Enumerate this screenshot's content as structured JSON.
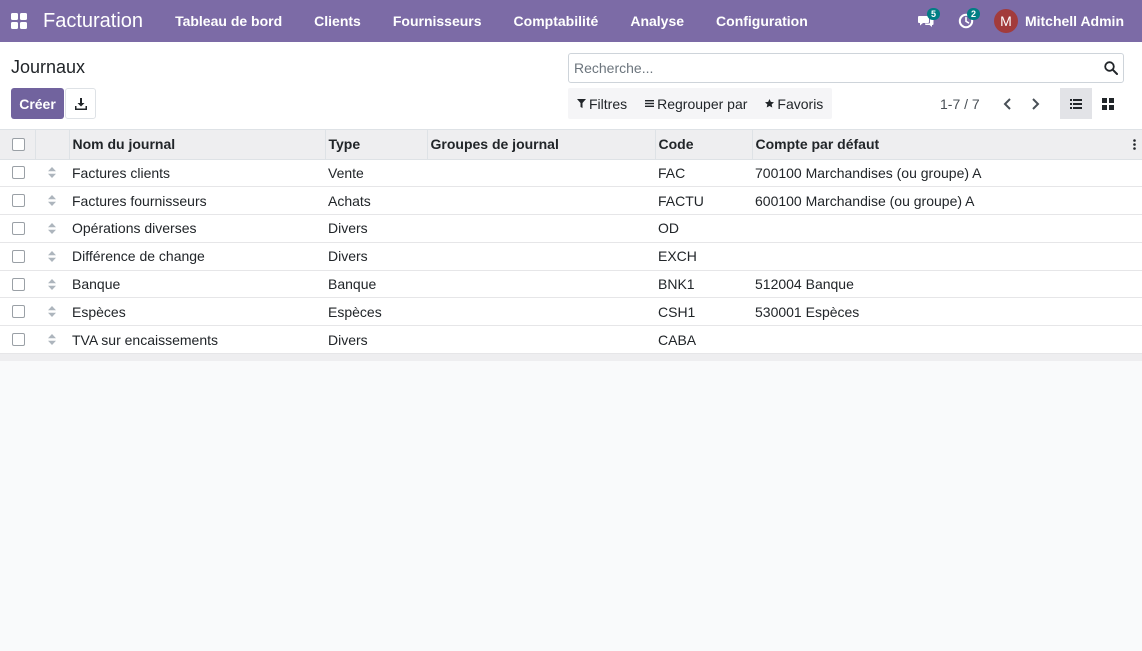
{
  "navbar": {
    "app_name": "Facturation",
    "menu": [
      "Tableau de bord",
      "Clients",
      "Fournisseurs",
      "Comptabilité",
      "Analyse",
      "Configuration"
    ],
    "messages_badge": "5",
    "activities_badge": "2",
    "user_initial": "M",
    "user_name": "Mitchell Admin",
    "icons": [
      "apps-icon",
      "chat-icon",
      "clock-icon"
    ]
  },
  "control_panel": {
    "title": "Journaux",
    "create_label": "Créer",
    "search_placeholder": "Recherche...",
    "filters_label": "Filtres",
    "group_by_label": "Regrouper par",
    "favorites_label": "Favoris",
    "pager_value": "1-7 / 7"
  },
  "table": {
    "columns": [
      "Nom du journal",
      "Type",
      "Groupes de journal",
      "Code",
      "Compte par défaut"
    ],
    "rows": [
      {
        "name": "Factures clients",
        "type": "Vente",
        "groups": "",
        "code": "FAC",
        "account": "700100 Marchandises (ou groupe) A"
      },
      {
        "name": "Factures fournisseurs",
        "type": "Achats",
        "groups": "",
        "code": "FACTU",
        "account": "600100 Marchandise (ou groupe) A"
      },
      {
        "name": "Opérations diverses",
        "type": "Divers",
        "groups": "",
        "code": "OD",
        "account": ""
      },
      {
        "name": "Différence de change",
        "type": "Divers",
        "groups": "",
        "code": "EXCH",
        "account": ""
      },
      {
        "name": "Banque",
        "type": "Banque",
        "groups": "",
        "code": "BNK1",
        "account": "512004 Banque"
      },
      {
        "name": "Espèces",
        "type": "Espèces",
        "groups": "",
        "code": "CSH1",
        "account": "530001 Espèces"
      },
      {
        "name": "TVA sur encaissements",
        "type": "Divers",
        "groups": "",
        "code": "CABA",
        "account": ""
      }
    ]
  },
  "colors": {
    "navbar": "#7c6ba6",
    "primary": "#71639e",
    "badge": "#017e84",
    "avatar": "#a23b3b"
  }
}
